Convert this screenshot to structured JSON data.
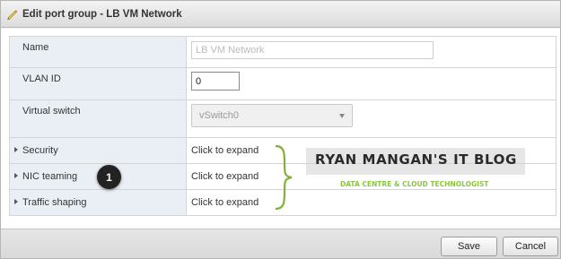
{
  "dialog": {
    "title": "Edit port group - LB VM Network"
  },
  "form": {
    "name": {
      "label": "Name",
      "placeholder": "LB VM Network",
      "value": ""
    },
    "vlan": {
      "label": "VLAN ID",
      "value": "0"
    },
    "vswitch": {
      "label": "Virtual switch",
      "selected": "vSwitch0"
    },
    "sections": [
      {
        "label": "Security",
        "action": "Click to expand"
      },
      {
        "label": "NIC teaming",
        "action": "Click to expand"
      },
      {
        "label": "Traffic shaping",
        "action": "Click to expand"
      }
    ]
  },
  "annotation": {
    "badge": "1"
  },
  "watermark": {
    "title": "RYAN MANGAN'S IT BLOG",
    "subtitle": "DATA CENTRE & CLOUD TECHNOLOGIST"
  },
  "footer": {
    "save_label": "Save",
    "cancel_label": "Cancel"
  },
  "icons": {
    "title": "pencil-icon",
    "section": "expand-caret-icon",
    "select": "dropdown-arrow-icon"
  },
  "colors": {
    "label_bg": "#e9eff5",
    "watermark_green": "#8cc63f"
  }
}
